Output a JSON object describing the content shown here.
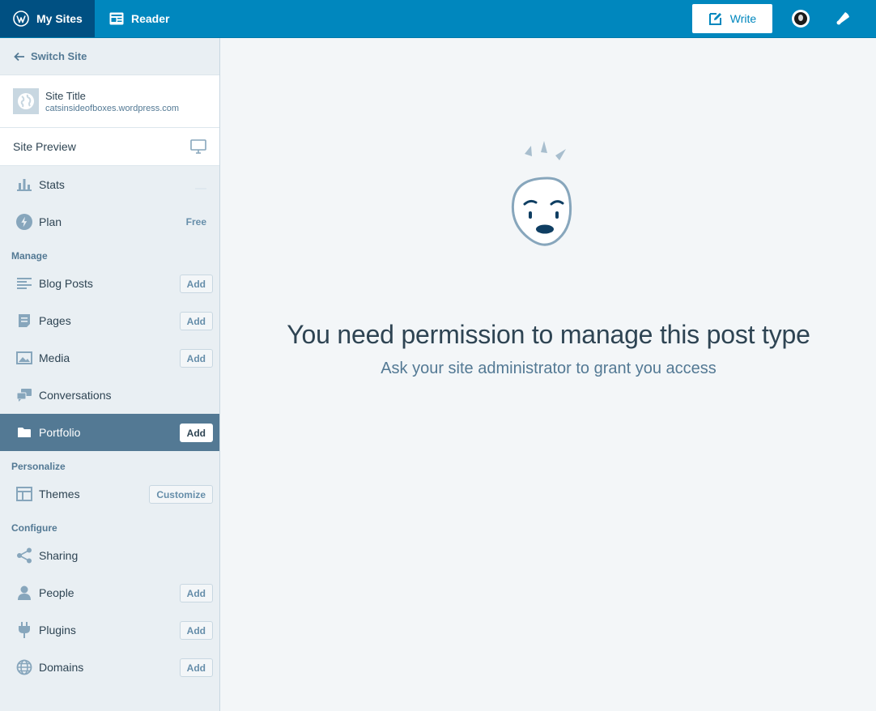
{
  "masterbar": {
    "my_sites": "My Sites",
    "reader": "Reader",
    "write": "Write"
  },
  "sidebar": {
    "switch_site": "Switch Site",
    "site_title": "Site Title",
    "site_domain": "catsinsideofboxes.wordpress.com",
    "site_preview": "Site Preview",
    "stats": "Stats",
    "plan": "Plan",
    "plan_badge": "Free",
    "manage_header": "Manage",
    "blog_posts": "Blog Posts",
    "pages": "Pages",
    "media": "Media",
    "conversations": "Conversations",
    "portfolio": "Portfolio",
    "personalize_header": "Personalize",
    "themes": "Themes",
    "customize": "Customize",
    "configure_header": "Configure",
    "sharing": "Sharing",
    "people": "People",
    "plugins": "Plugins",
    "domains": "Domains",
    "add_label": "Add"
  },
  "main": {
    "title": "You need permission to manage this post type",
    "line": "Ask your site administrator to grant you access"
  },
  "colors": {
    "masterbar": "#0087be",
    "masterbar_active": "#005082",
    "sidebar_bg": "#e9eff3",
    "selected": "#537994",
    "main_bg": "#f3f6f8"
  }
}
